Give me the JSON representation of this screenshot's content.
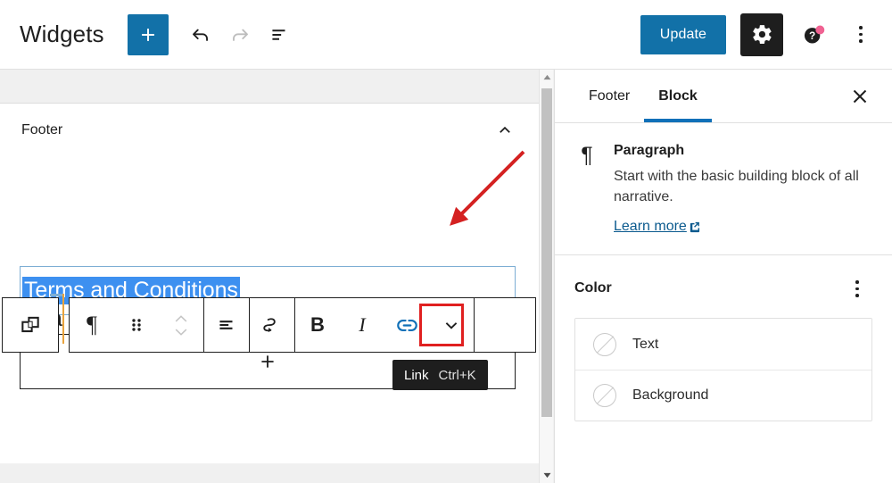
{
  "header": {
    "title": "Widgets",
    "add_block_label": "+",
    "add_block_icon": "plus-icon",
    "undo_icon": "undo-arrow-icon",
    "redo_icon": "redo-arrow-icon",
    "list_view_icon": "list-view-icon",
    "update_label": "Update",
    "settings_icon": "gear-icon",
    "help_icon": "help-question-icon",
    "more_icon": "vertical-ellipsis-icon",
    "accent_color": "#1271a8",
    "badge_color": "#f06292"
  },
  "editor": {
    "widget_area": {
      "title": "Footer",
      "collapse_icon": "chevron-up-icon"
    },
    "paragraph_block": {
      "text": "Terms and Conditions",
      "selection_color": "#3d90f0",
      "selected": true
    },
    "appender": {
      "label": "+",
      "icon": "plus-icon"
    },
    "hidden_block_peek": "a",
    "scrollbar": {
      "up_icon": "scroll-up-arrow-icon",
      "down_icon": "scroll-down-arrow-icon"
    }
  },
  "block_toolbar": {
    "copy_blocks_icon": "copy-blocks-icon",
    "items": [
      {
        "name": "paragraph-type",
        "icon": "pilcrow-icon",
        "glyph": "¶"
      },
      {
        "name": "drag-handle",
        "icon": "drag-handle-icon"
      },
      {
        "name": "move-updown",
        "icon": "move-up-down-icon"
      },
      {
        "name": "align-text",
        "icon": "align-text-icon"
      },
      {
        "name": "transform-arrow",
        "icon": "curved-arrow-icon"
      },
      {
        "name": "bold",
        "icon": "bold-icon",
        "glyph": "B"
      },
      {
        "name": "italic",
        "icon": "italic-icon",
        "glyph": "I"
      },
      {
        "name": "link",
        "icon": "link-icon",
        "active": true
      },
      {
        "name": "more-options",
        "icon": "chevron-down-icon"
      }
    ],
    "link_active_color": "#1070b8",
    "highlight_color": "#e02020"
  },
  "tooltip": {
    "label": "Link",
    "shortcut": "Ctrl+K"
  },
  "annotation": {
    "arrow_color": "#d42121"
  },
  "sidebar": {
    "tabs": [
      {
        "label": "Footer",
        "active": false
      },
      {
        "label": "Block",
        "active": true
      }
    ],
    "close_icon": "close-icon",
    "active_underline_color": "#1070b8",
    "block_info": {
      "icon": "pilcrow-icon",
      "icon_glyph": "¶",
      "name": "Paragraph",
      "description": "Start with the basic building block of all narrative.",
      "learn_more_label": "Learn more",
      "learn_more_icon": "external-link-icon"
    },
    "color_panel": {
      "title": "Color",
      "more_icon": "vertical-ellipsis-icon",
      "options": [
        {
          "label": "Text",
          "value": "none",
          "swatch_icon": "no-color-icon"
        },
        {
          "label": "Background",
          "value": "none",
          "swatch_icon": "no-color-icon"
        }
      ]
    }
  }
}
